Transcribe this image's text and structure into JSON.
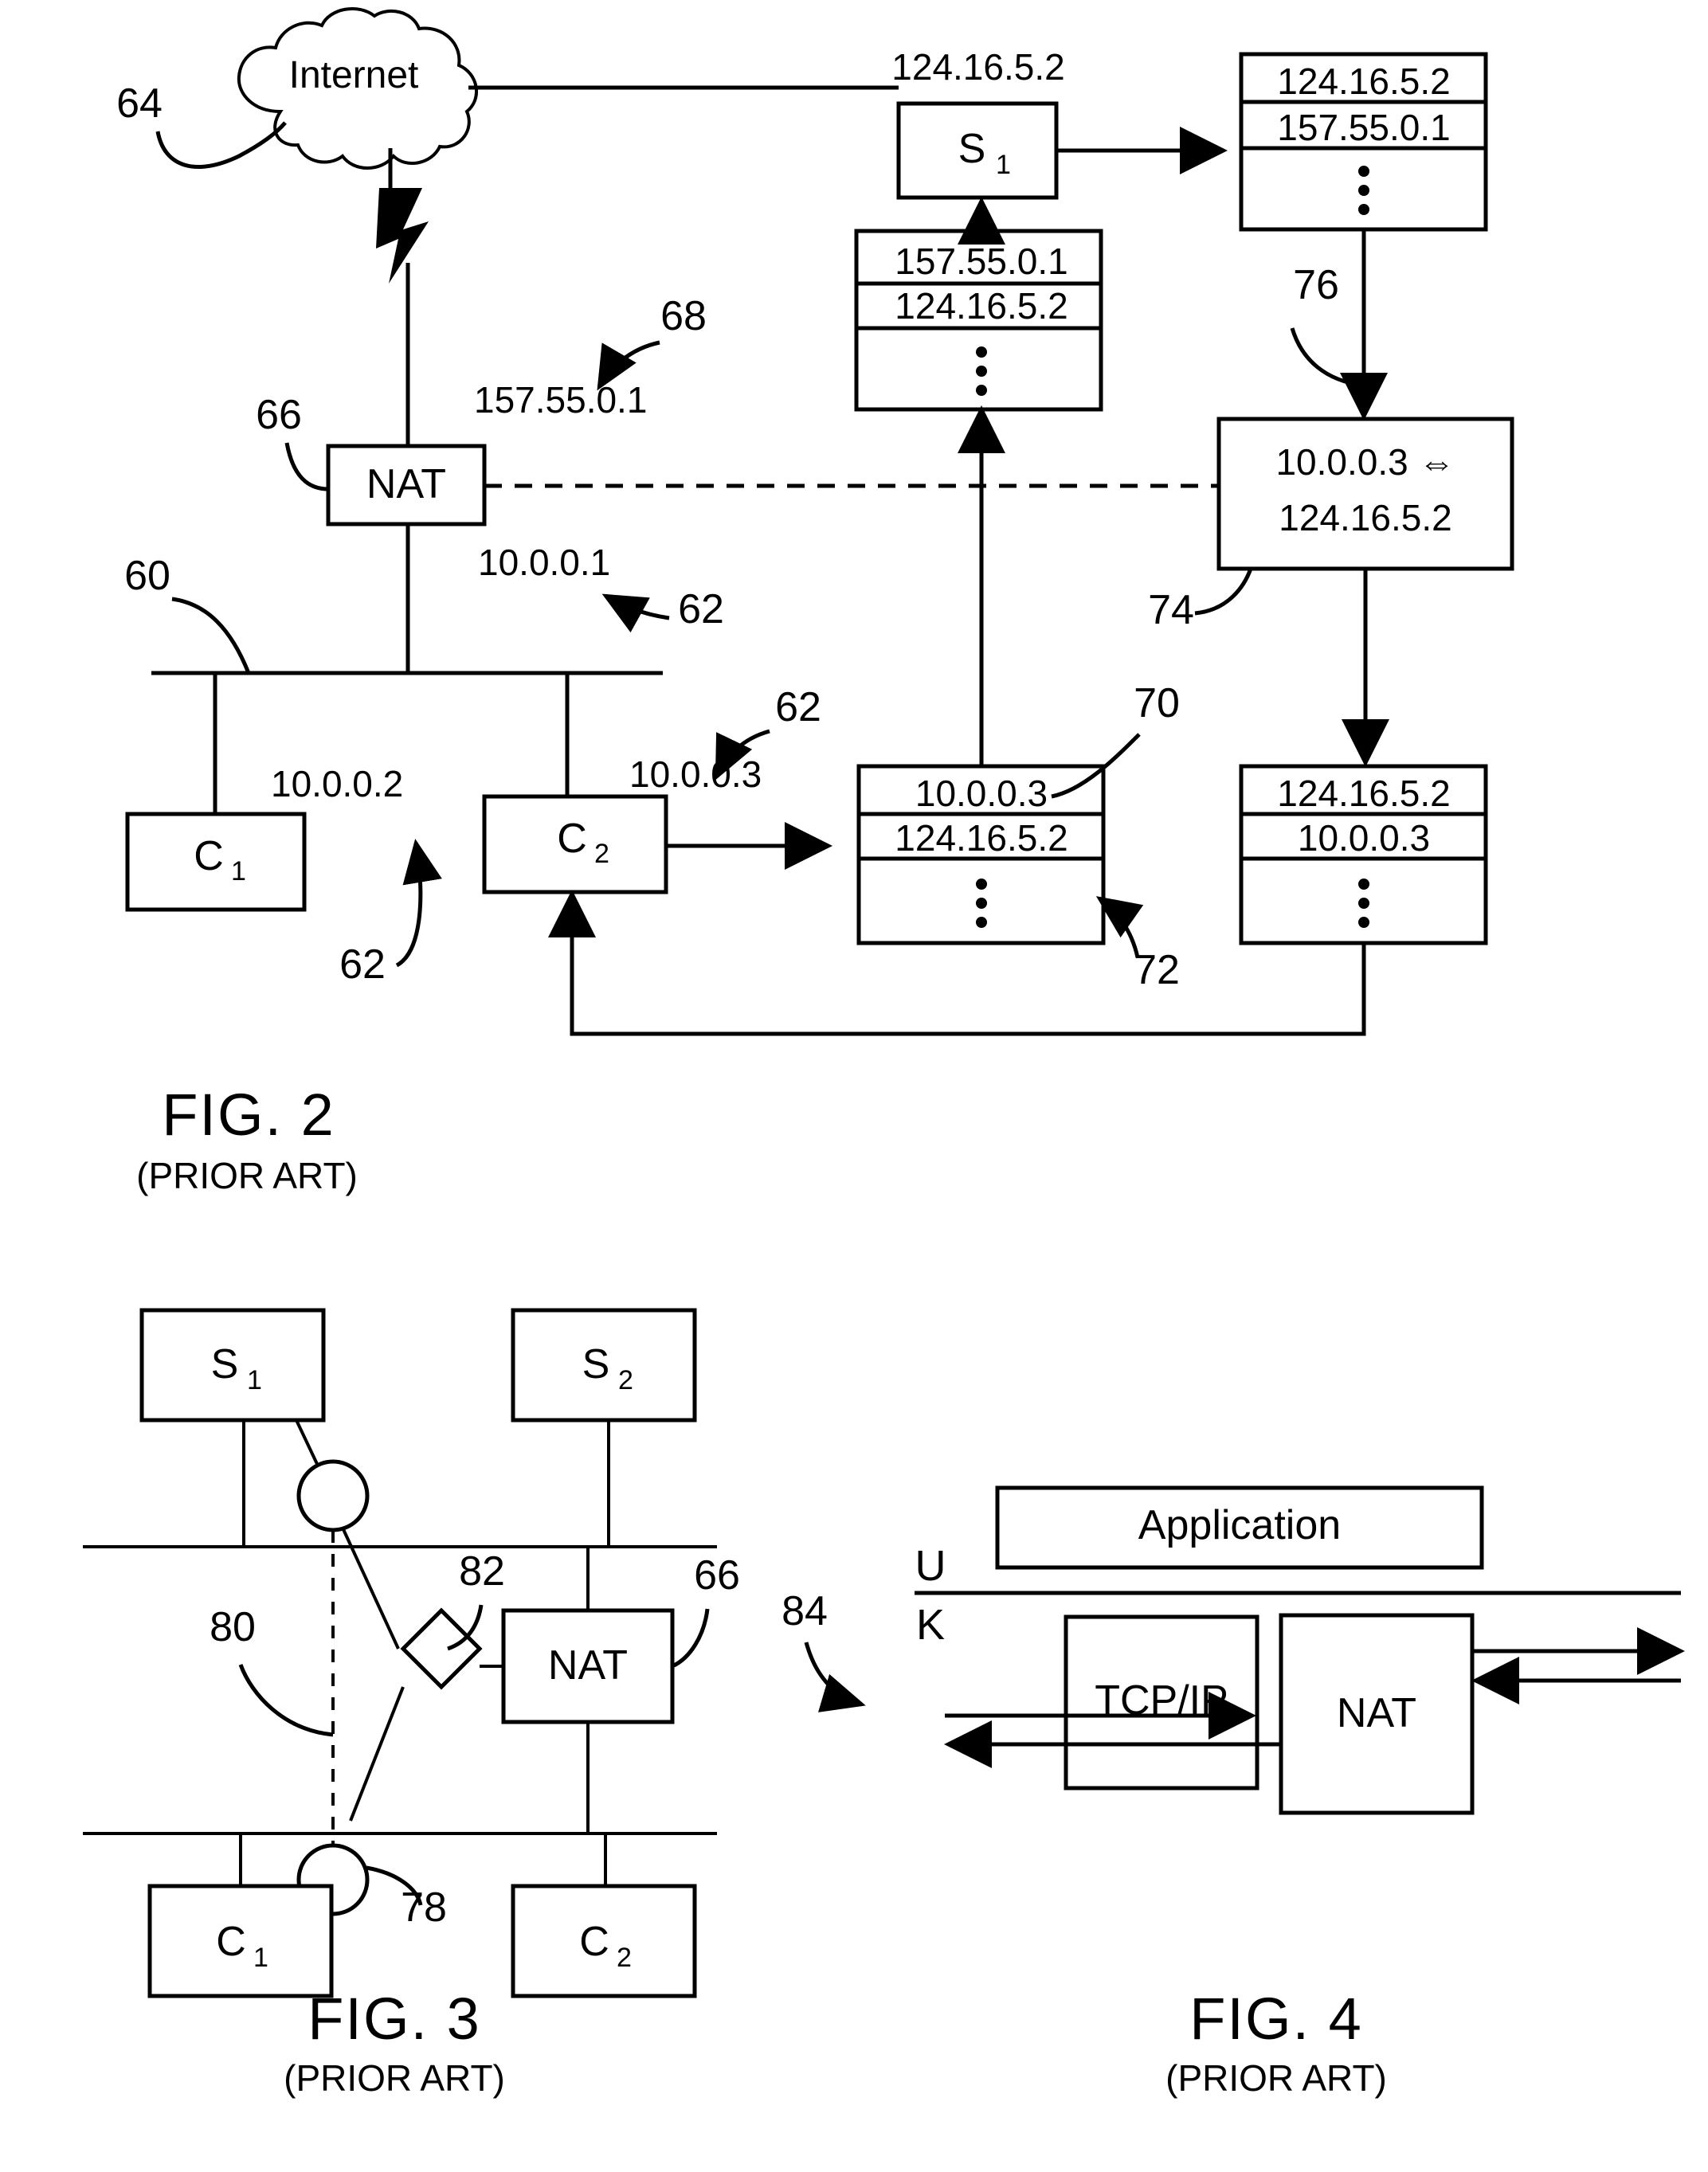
{
  "document": {
    "kind": "patent-drawing-sheet",
    "figures": [
      "FIG. 2",
      "FIG. 3",
      "FIG. 4"
    ]
  },
  "fig2": {
    "caption": "FIG. 2",
    "caption_note": "(PRIOR ART)",
    "cloud_label": "Internet",
    "nat_label": "NAT",
    "client1_label": "C",
    "client1_sub": "1",
    "client2_label": "C",
    "client2_sub": "2",
    "server1_label": "S",
    "server1_sub": "1",
    "ip_server1": "124.16.5.2",
    "ip_nat_public": "157.55.0.1",
    "ip_nat_private": "10.0.0.1",
    "ip_client1": "10.0.0.2",
    "ip_client2": "10.0.0.3",
    "refs": {
      "r60": "60",
      "r62_a": "62",
      "r62_b": "62",
      "r62_c": "62",
      "r64": "64",
      "r66": "66",
      "r68": "68",
      "r70": "70",
      "r72": "72",
      "r74": "74",
      "r76": "76"
    },
    "packet_tables": [
      {
        "name": "packet-c2-outbound",
        "rows": [
          "10.0.0.3",
          "124.16.5.2"
        ],
        "ellipsis": true
      },
      {
        "name": "packet-nat-outbound",
        "rows": [
          "157.55.0.1",
          "124.16.5.2"
        ],
        "ellipsis": true
      },
      {
        "name": "packet-s1-reply",
        "rows": [
          "124.16.5.2",
          "157.55.0.1"
        ],
        "ellipsis": true
      },
      {
        "name": "packet-nat-inbound",
        "rows": [
          "124.16.5.2",
          "10.0.0.3"
        ],
        "ellipsis": true
      }
    ],
    "mapping_box": {
      "line1": "10.0.0.3 ⇔",
      "line2": "124.16.5.2"
    }
  },
  "fig3": {
    "caption": "FIG. 3",
    "caption_note": "(PRIOR ART)",
    "server1_label": "S",
    "server1_sub": "1",
    "server2_label": "S",
    "server2_sub": "2",
    "client1_label": "C",
    "client1_sub": "1",
    "client2_label": "C",
    "client2_sub": "2",
    "nat_label": "NAT",
    "refs": {
      "r66": "66",
      "r78": "78",
      "r80": "80",
      "r82": "82"
    }
  },
  "fig4": {
    "caption": "FIG. 4",
    "caption_note": "(PRIOR ART)",
    "application_label": "Application",
    "tcpip_label": "TCP/IP",
    "nat_label": "NAT",
    "user_space_label": "U",
    "kernel_space_label": "K",
    "refs": {
      "r84": "84"
    }
  }
}
